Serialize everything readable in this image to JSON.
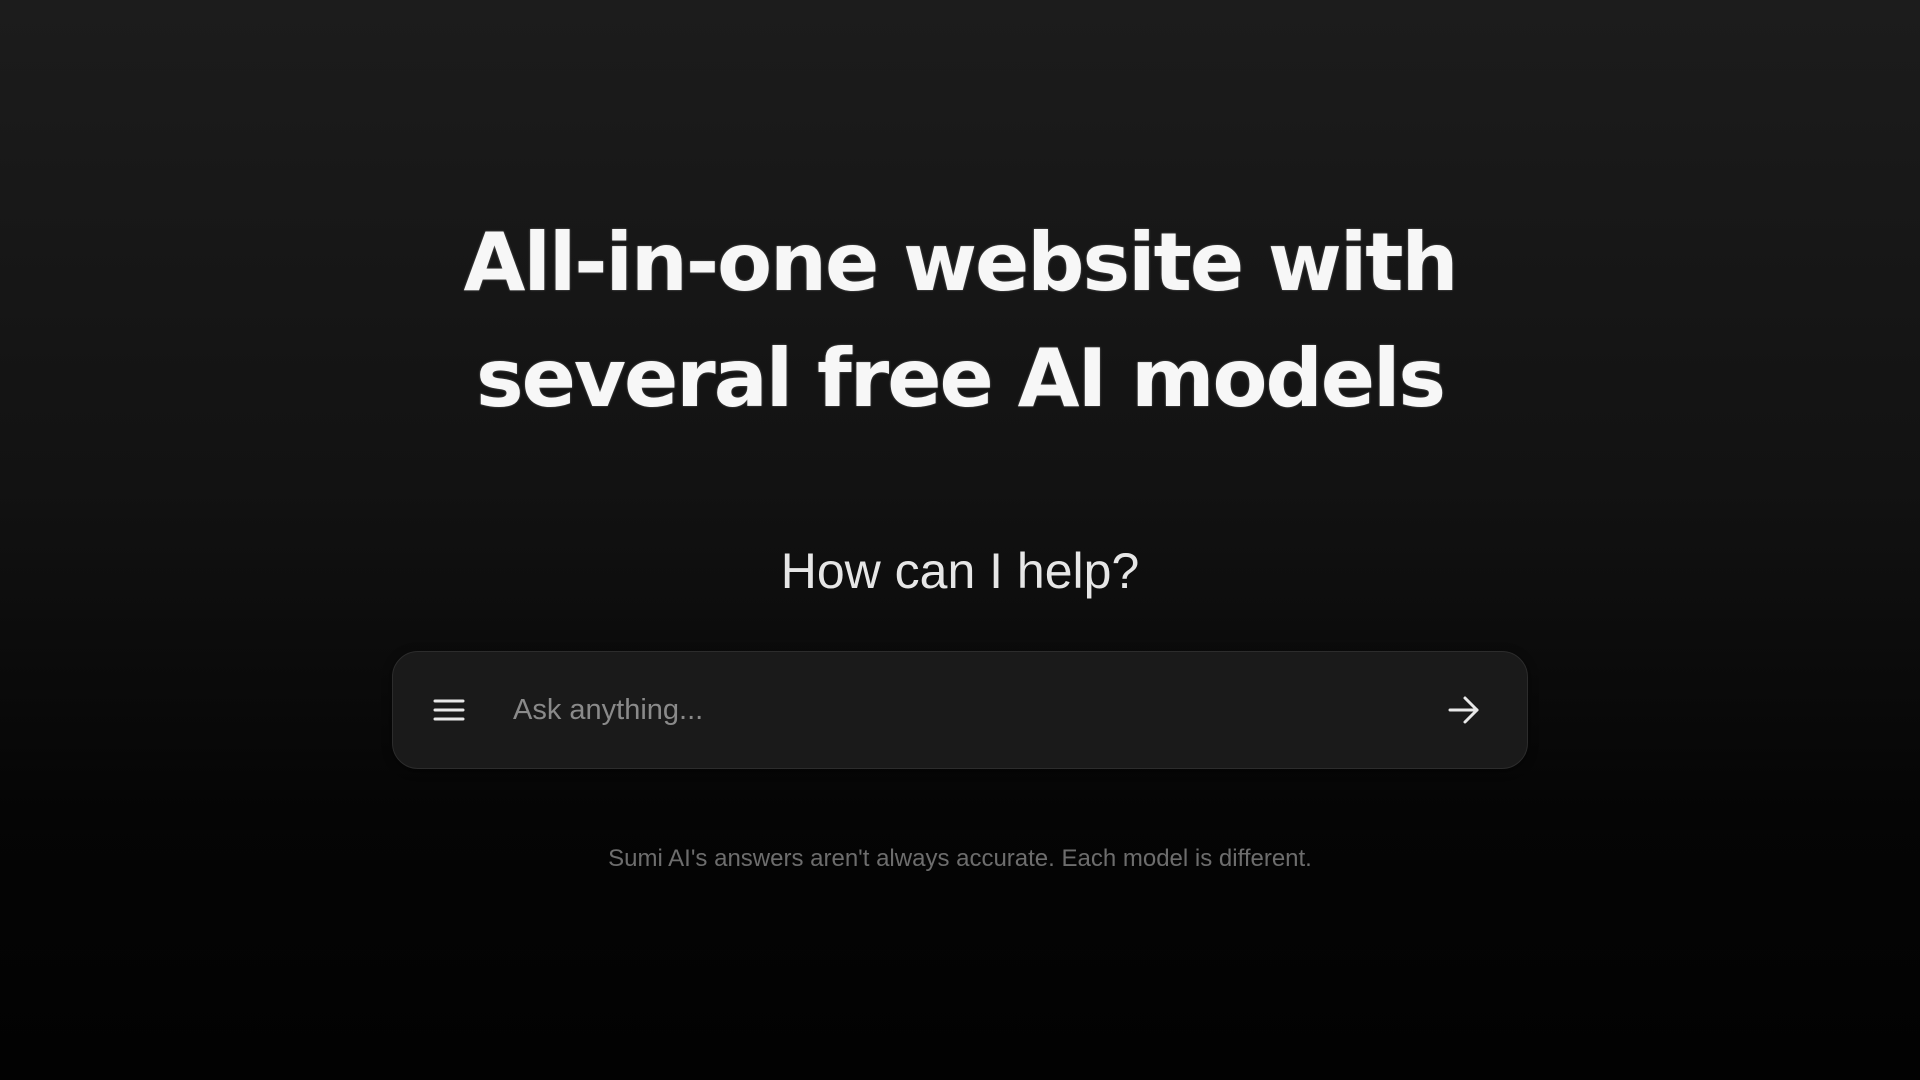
{
  "hero": {
    "title_line1": "All-in-one website with",
    "title_line2": "several free AI models"
  },
  "prompt": {
    "heading": "How can I help?"
  },
  "chat_bar": {
    "menu_icon": "menu-icon",
    "input_placeholder": "Ask anything...",
    "input_value": "",
    "send_icon": "arrow-right-icon"
  },
  "footer": {
    "disclaimer": "Sumi AI's answers aren't always accurate. Each model is different."
  },
  "colors": {
    "background_top": "#1c1c1c",
    "background_bottom": "#020202",
    "input_background": "#1a1a1a",
    "title_text": "#f7f7f7",
    "disclaimer_text": "#6d6d6d"
  }
}
